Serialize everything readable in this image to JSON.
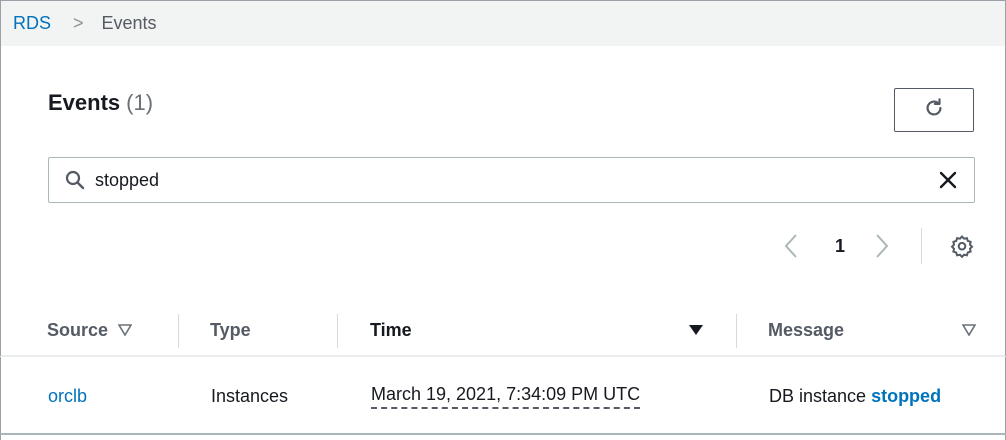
{
  "breadcrumb": {
    "root": "RDS",
    "separator": ">",
    "current": "Events"
  },
  "panel": {
    "title": "Events",
    "count": "(1)"
  },
  "refresh": {
    "icon": "refresh-icon"
  },
  "search": {
    "value": "stopped",
    "icon": "search-icon",
    "clear_icon": "close-icon"
  },
  "pagination": {
    "current_page": "1",
    "prev_icon": "chevron-left-icon",
    "next_icon": "chevron-right-icon",
    "settings_icon": "gear-icon"
  },
  "table": {
    "columns": [
      {
        "label": "Source",
        "sortable": true
      },
      {
        "label": "Type",
        "sortable": false
      },
      {
        "label": "Time",
        "sortable": true,
        "sorted": "desc"
      },
      {
        "label": "Message",
        "sortable": true
      }
    ],
    "rows": [
      {
        "source": "orclb",
        "type": "Instances",
        "time": "March 19, 2021, 7:34:09 PM UTC",
        "message_prefix": "DB instance",
        "message_highlight": "stopped"
      }
    ]
  },
  "colors": {
    "link": "#0073bb",
    "text": "#16191f",
    "muted": "#545b64"
  }
}
